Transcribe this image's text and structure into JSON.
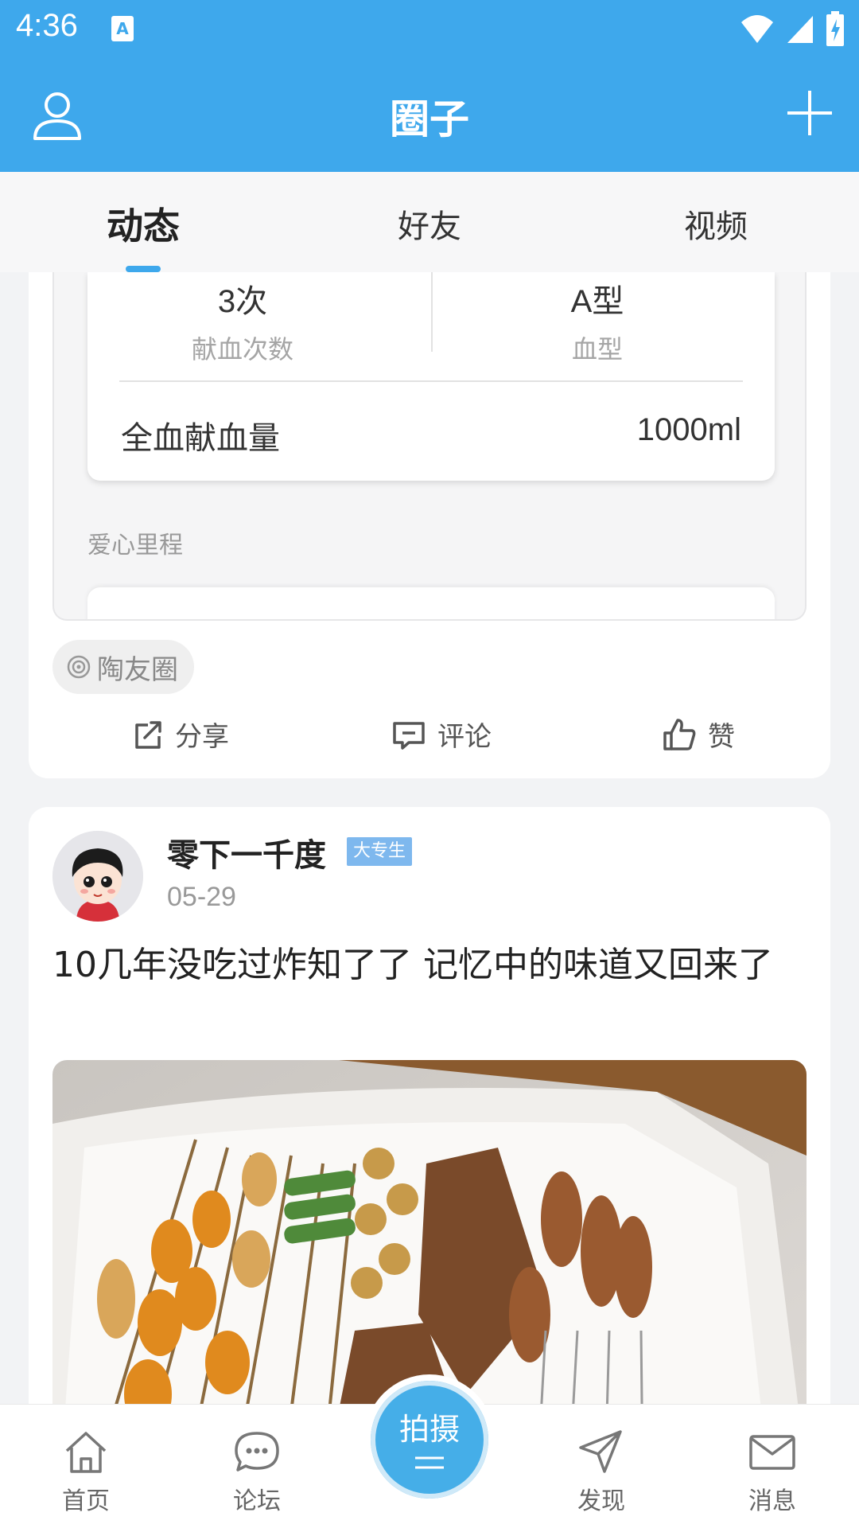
{
  "status_bar": {
    "time": "4:36",
    "notification_icon": "A"
  },
  "app_bar": {
    "title": "圈子"
  },
  "tabs": [
    {
      "label": "动态",
      "active": true
    },
    {
      "label": "好友",
      "active": false
    },
    {
      "label": "视频",
      "active": false
    }
  ],
  "post1": {
    "stats": [
      {
        "value": "3次",
        "label": "献血次数"
      },
      {
        "value": "A型",
        "label": "血型"
      }
    ],
    "volume_label": "全血献血量",
    "volume_value": "1000ml",
    "journey_label": "爱心里程",
    "circle_tag": "陶友圈",
    "actions": {
      "share": "分享",
      "comment": "评论",
      "like": "赞"
    }
  },
  "post2": {
    "username": "零下一千度",
    "badge": "大专生",
    "date": "05-29",
    "text": "10几年没吃过炸知了了 记忆中的味道又回来了"
  },
  "bottom_nav": {
    "home": "首页",
    "forum": "论坛",
    "shoot": "拍摄",
    "discover": "发现",
    "messages": "消息"
  },
  "colors": {
    "primary": "#3ea8ec",
    "fab": "#45aee8",
    "badge": "#7eb8ee"
  }
}
